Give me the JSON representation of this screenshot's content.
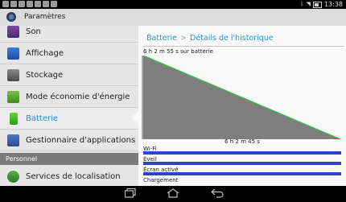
{
  "status_bar": {
    "time": "13:38",
    "left_icons": [
      "screenshot-icon",
      "notification-icon",
      "notification-icon",
      "notification-icon",
      "notification-icon",
      "notification-icon",
      "notification-icon"
    ],
    "right_icons": [
      "bluetooth-icon",
      "wifi-icon",
      "battery-icon"
    ]
  },
  "action_bar": {
    "title": "Paramètres"
  },
  "sidebar": {
    "items": [
      {
        "label": "Son",
        "icon": "speaker-icon"
      },
      {
        "label": "Affichage",
        "icon": "display-icon"
      },
      {
        "label": "Stockage",
        "icon": "storage-icon"
      },
      {
        "label": "Mode économie d'énergie",
        "icon": "power-saving-icon"
      },
      {
        "label": "Batterie",
        "icon": "battery-icon",
        "selected": true
      },
      {
        "label": "Gestionnaire d'applications",
        "icon": "apps-icon"
      }
    ],
    "section_header": "Personnel",
    "section_items": [
      {
        "label": "Services de localisation",
        "icon": "location-icon"
      }
    ]
  },
  "breadcrumb": {
    "parent": "Batterie",
    "current": "Détails de l'historique"
  },
  "chart_data": {
    "type": "area",
    "title": "6 h 2 m 55 s sur batterie",
    "xlabel": "6 h 2 m 45 s",
    "series": [
      {
        "values": [
          100,
          0
        ]
      }
    ],
    "ylim": [
      0,
      100
    ],
    "colors": {
      "fill": "#7e7e7e",
      "line": "#33c24a",
      "line_end": "#d8402a"
    }
  },
  "indicators": [
    {
      "label": "Wi-Fi",
      "fill": 1.0
    },
    {
      "label": "Éveil",
      "fill": 1.0
    },
    {
      "label": "Écran activé",
      "fill": 1.0
    },
    {
      "label": "Chargement",
      "fill": 0.0
    }
  ],
  "colors": {
    "accent": "#1d8fd6",
    "indicator": "#2d44c9",
    "section": "#7a7a7a"
  }
}
